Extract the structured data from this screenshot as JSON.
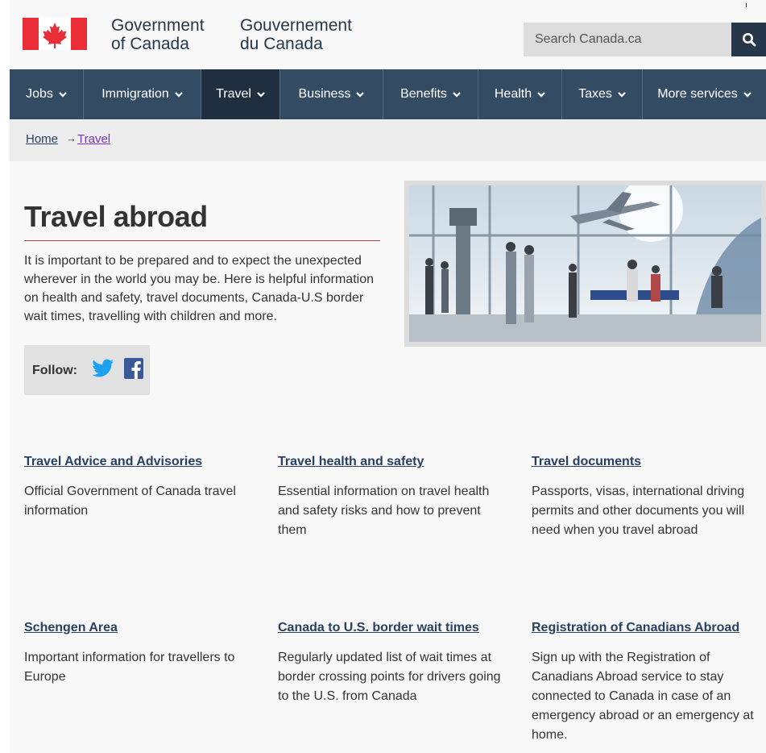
{
  "header": {
    "signature_en": [
      "Government",
      "of Canada"
    ],
    "signature_fr": [
      "Gouvernement",
      "du Canada"
    ],
    "search_placeholder": "Search Canada.ca",
    "search_icon": "magnifier-icon",
    "flag_icon": "canada-flag-icon"
  },
  "nav": {
    "items": [
      {
        "label": "Jobs"
      },
      {
        "label": "Immigration"
      },
      {
        "label": "Travel"
      },
      {
        "label": "Business"
      },
      {
        "label": "Benefits"
      },
      {
        "label": "Health"
      },
      {
        "label": "Taxes"
      },
      {
        "label": "More services"
      }
    ],
    "active": "Travel"
  },
  "breadcrumb": {
    "home": "Home",
    "arrow": "→",
    "current": "Travel"
  },
  "hero": {
    "title": "Travel abroad",
    "lead": "It is important to be prepared and to expect the unexpected wherever in the world you may be. Here is helpful information on health and safety, travel documents, Canada-U.S border wait times, travelling with children and more.",
    "follow_label": "Follow:",
    "icons": [
      "twitter-icon",
      "facebook-icon"
    ]
  },
  "tiles": [
    {
      "title": "Travel Advice and Advisories",
      "desc": "Official Government of Canada travel information"
    },
    {
      "title": "Travel health and safety",
      "desc": "Essential information on travel health and safety risks and how to prevent them"
    },
    {
      "title": "Travel documents",
      "desc": "Passports, visas, international driving permits and other documents you will need when you travel abroad"
    },
    {
      "title": "Schengen Area",
      "desc": "Important information for travellers to Europe"
    },
    {
      "title": "Canada to U.S. border wait times",
      "desc": "Regularly updated list of wait times at border crossing points for drivers going to the U.S. from Canada"
    },
    {
      "title": "Registration of Canadians Abroad",
      "desc": "Sign up with the Registration of Canadians Abroad service to stay connected to Canada in case of an emergency abroad or an emergency at home."
    }
  ],
  "colors": {
    "nav_bg": "#334b63",
    "nav_active": "#1f2f3f",
    "link": "#284162",
    "visited_link": "#7834bc",
    "flag_red": "#eb2d37",
    "title_rule": "#af3c43"
  }
}
